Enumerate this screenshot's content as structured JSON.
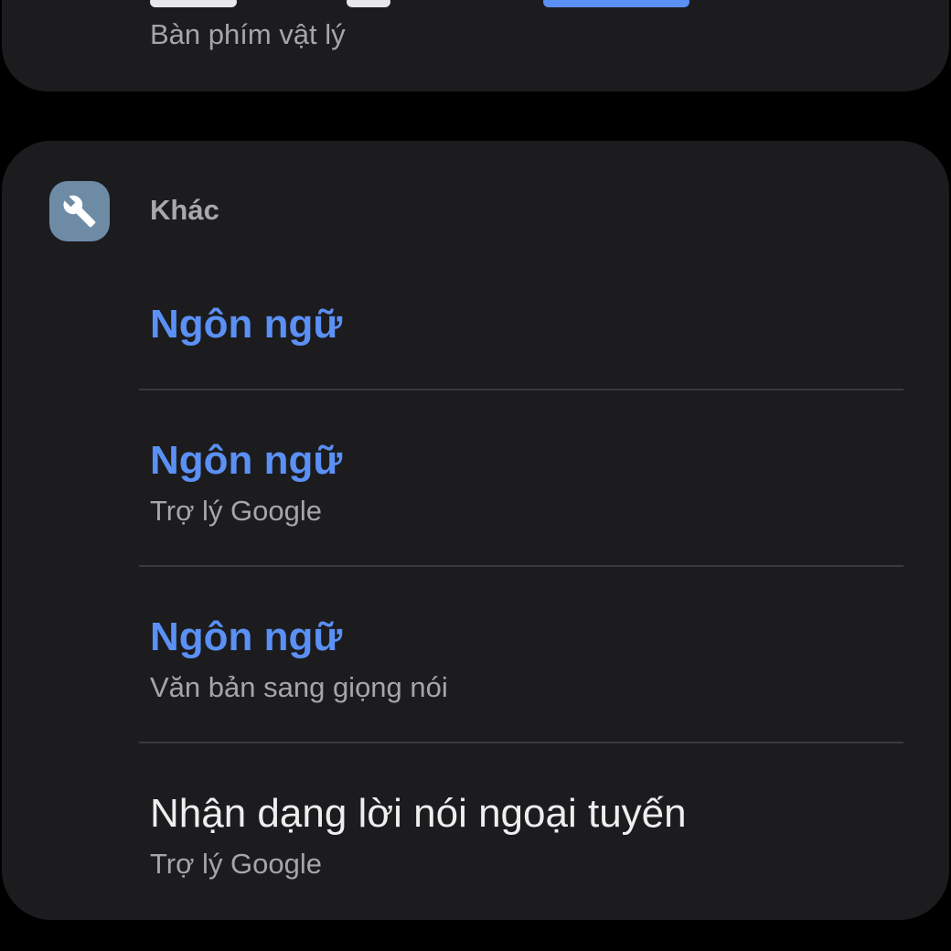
{
  "top_card": {
    "subtitle": "Bàn phím vật lý"
  },
  "section": {
    "icon": "wrench-icon",
    "title": "Khác",
    "icon_color": "#6e8ba6"
  },
  "items": [
    {
      "title": "Ngôn ngữ",
      "subtitle": ""
    },
    {
      "title": "Ngôn ngữ",
      "subtitle": "Trợ lý Google"
    },
    {
      "title": "Ngôn ngữ",
      "subtitle": "Văn bản sang giọng nói"
    },
    {
      "title": "Nhận dạng lời nói ngoại tuyến",
      "subtitle": "Trợ lý Google"
    }
  ],
  "colors": {
    "background": "#000000",
    "card": "#1c1c1f",
    "accent": "#5b90f5",
    "secondary_text": "#a5a5aa",
    "primary_text": "#eeeeef",
    "divider": "#3a3a3e"
  }
}
